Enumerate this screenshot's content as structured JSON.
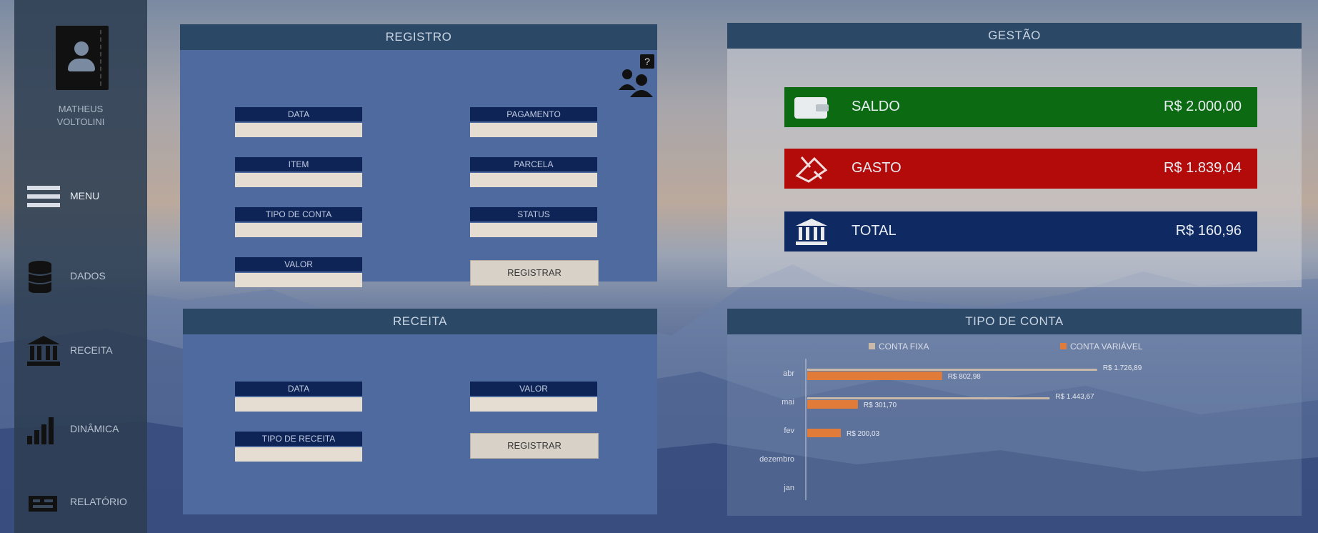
{
  "colors": {
    "sidebar_bg": "#2c3e52",
    "panel_header": "#2b4866",
    "registro_body": "#4f6a9e",
    "field_label": "#0e2457",
    "field_input": "#e5ddd2",
    "saldo": "#0b6a12",
    "gasto": "#b30a0a",
    "total": "#0f2a63",
    "bar_variavel": "#e07b39"
  },
  "sidebar": {
    "user_name": "MATHEUS\nVOLTOLINI",
    "items": [
      {
        "label": "MENU",
        "icon": "hamburger-icon"
      },
      {
        "label": "DADOS",
        "icon": "database-icon"
      },
      {
        "label": "RECEITA",
        "icon": "bank-icon"
      },
      {
        "label": "DINÂMICA",
        "icon": "bar-chart-icon"
      },
      {
        "label": "RELATÓRIO",
        "icon": "report-icon"
      }
    ]
  },
  "registro": {
    "title": "REGISTRO",
    "fields": {
      "data": "DATA",
      "item": "ITEM",
      "tipo_conta": "TIPO DE CONTA",
      "valor": "VALOR",
      "pagamento": "PAGAMENTO",
      "parcela": "PARCELA",
      "status": "STATUS"
    },
    "button": "REGISTRAR"
  },
  "receita": {
    "title": "RECEITA",
    "fields": {
      "data": "DATA",
      "tipo_receita": "TIPO DE RECEITA",
      "valor": "VALOR"
    },
    "button": "REGISTRAR"
  },
  "gestao": {
    "title": "GESTÃO",
    "saldo": {
      "label": "SALDO",
      "value": "R$ 2.000,00",
      "icon": "wallet-icon"
    },
    "gasto": {
      "label": "GASTO",
      "value": "R$ 1.839,04",
      "icon": "money-wings-icon"
    },
    "total": {
      "label": "TOTAL",
      "value": "R$ 160,96",
      "icon": "bank-icon"
    }
  },
  "tipo_conta": {
    "title": "TIPO DE CONTA",
    "chart_data": {
      "type": "bar",
      "orientation": "horizontal",
      "categories": [
        "abr",
        "mai",
        "fev",
        "dezembro",
        "jan"
      ],
      "series": [
        {
          "name": "CONTA FIXA",
          "values": [
            1726.89,
            1443.67,
            0,
            0,
            0
          ],
          "labels": [
            "R$ 1.726,89",
            "R$ 1.443,67",
            "",
            "",
            ""
          ]
        },
        {
          "name": "CONTA VARIÁVEL",
          "values": [
            802.98,
            301.7,
            200.03,
            0,
            0
          ],
          "labels": [
            "R$ 802,98",
            "R$ 301,70",
            "R$ 200,03",
            "",
            ""
          ]
        }
      ],
      "xlim": [
        0,
        2000
      ],
      "legend": "top",
      "grid": false
    }
  }
}
